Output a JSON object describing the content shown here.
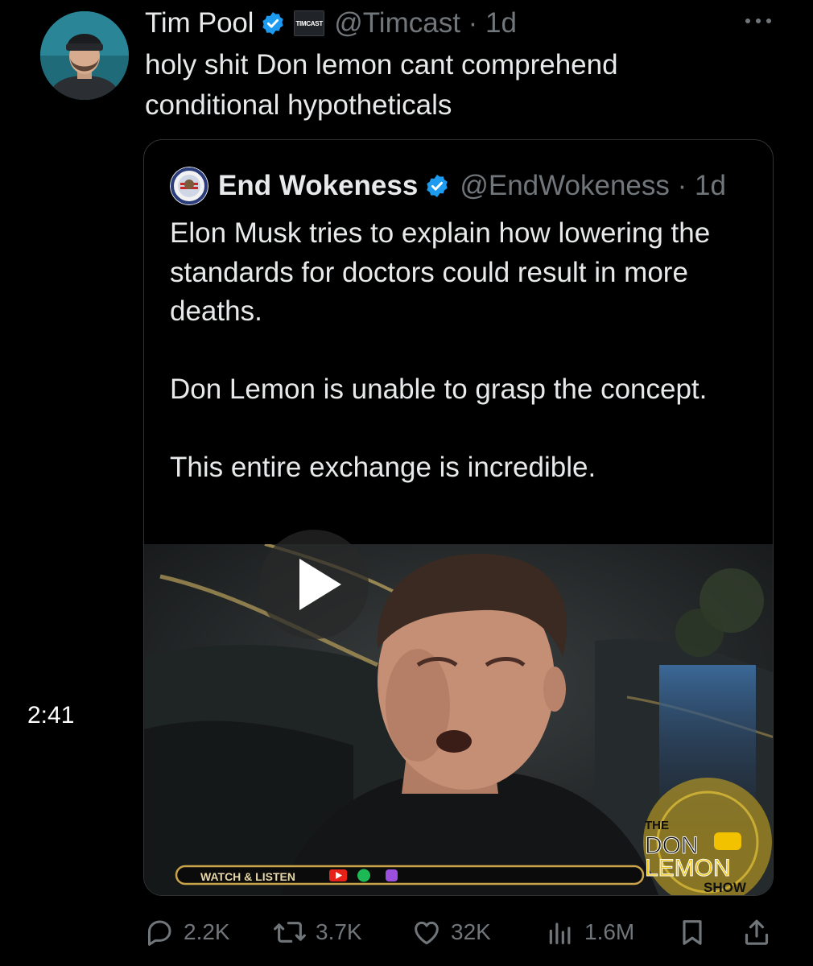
{
  "tweet": {
    "author": "Tim Pool",
    "affiliation_badge": "TIMCAST",
    "handle": "@Timcast",
    "time": "1d",
    "text": "holy shit Don lemon cant comprehend conditional hypotheticals"
  },
  "quoted_tweet": {
    "author": "End Wokeness",
    "handle": "@EndWokeness",
    "time": "1d",
    "text": "Elon Musk tries to explain how lowering the standards for doctors could result in more deaths.\n\nDon Lemon is unable to grasp the concept.\n\nThis entire exchange is incredible.",
    "video": {
      "duration": "2:41",
      "banner_text": "WATCH & LISTEN",
      "show_logo_line1": "THE",
      "show_logo_line2": "DON",
      "show_logo_line3": "LEMON",
      "show_logo_line4": "SHOW"
    }
  },
  "actions": {
    "replies": "2.2K",
    "reposts": "3.7K",
    "likes": "32K",
    "views": "1.6M"
  },
  "colors": {
    "background": "#000000",
    "text": "#e7e9ea",
    "muted": "#71767b",
    "verified": "#1d9bf0",
    "border": "#2f3336"
  },
  "icons": {
    "verified": "verified-badge-icon",
    "more": "more-icon",
    "reply": "reply-icon",
    "repost": "repost-icon",
    "like": "like-icon",
    "views": "views-icon",
    "bookmark": "bookmark-icon",
    "share": "share-icon",
    "play": "play-icon"
  }
}
